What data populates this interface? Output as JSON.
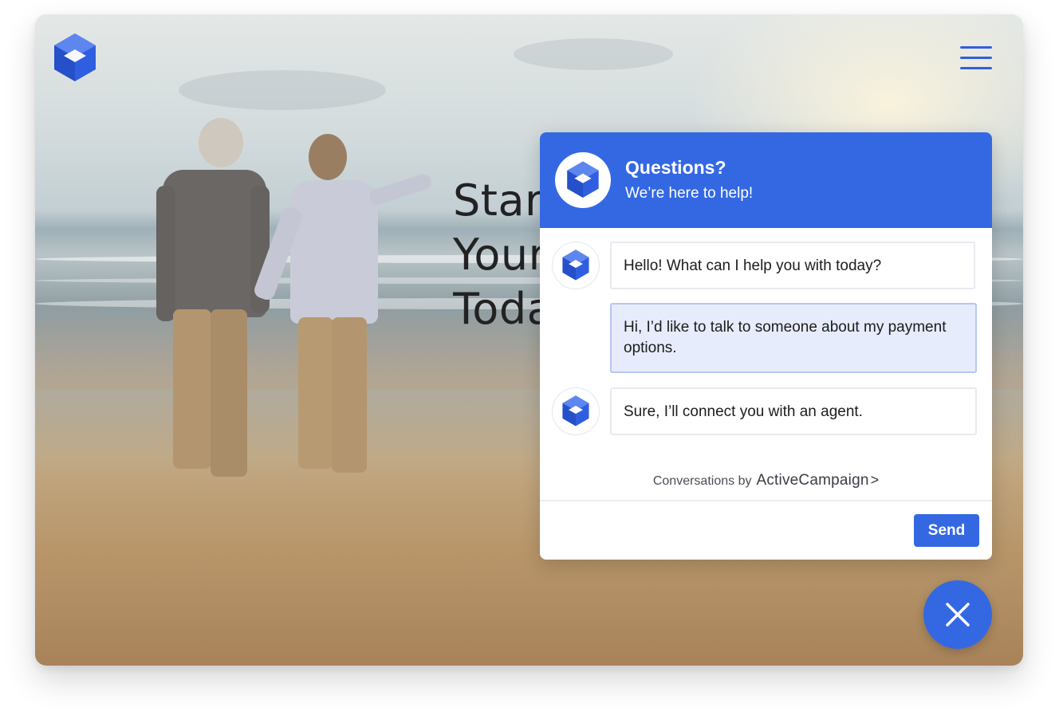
{
  "hero": {
    "title_lines": [
      "Start",
      "Your",
      "Today"
    ]
  },
  "chat": {
    "header_title": "Questions?",
    "header_subtitle": "We’re here to help!",
    "messages": [
      {
        "from": "bot",
        "text": "Hello! What can I help you with today?"
      },
      {
        "from": "user",
        "text": "Hi, I’d like to talk to someone about my payment options."
      },
      {
        "from": "bot",
        "text": "Sure, I’ll connect you with an agent."
      }
    ],
    "powered_by": "Conversations by",
    "brand": "ActiveCampaign",
    "brand_chevron": ">",
    "input_placeholder": "",
    "send_label": "Send"
  },
  "icons": {
    "logo": "cube-logo-icon",
    "menu": "hamburger-menu-icon",
    "close": "close-icon"
  },
  "colors": {
    "brand_blue": "#3468e3",
    "user_bubble": "#e6ecfb",
    "user_bubble_border": "#b6c7f1"
  }
}
